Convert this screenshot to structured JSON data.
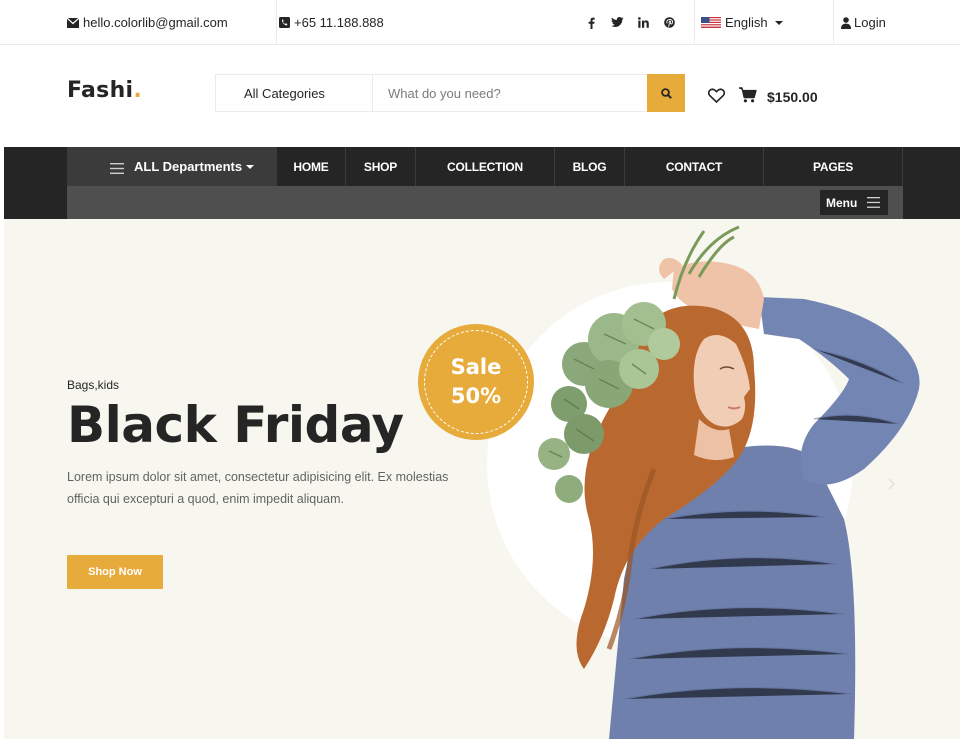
{
  "topbar": {
    "email": "hello.colorlib@gmail.com",
    "phone": "+65 11.188.888",
    "social_icons": [
      "facebook-icon",
      "twitter-icon",
      "linkedin-icon",
      "pinterest-icon"
    ],
    "language": "English",
    "login": "Login"
  },
  "header": {
    "logo_text": "Fashi",
    "logo_dot": ".",
    "category_select": "All Categories",
    "search_placeholder": "What do you need?",
    "cart_total": "$150.00"
  },
  "nav": {
    "departments": "ALL Departments",
    "items": [
      "HOME",
      "SHOP",
      "COLLECTION",
      "BLOG",
      "CONTACT",
      "PAGES"
    ],
    "menu_label": "Menu"
  },
  "hero": {
    "category": "Bags,kids",
    "title": "Black Friday",
    "description": "Lorem ipsum dolor sit amet, consectetur adipisicing elit. Ex molestias officia qui excepturi a quod, enim impedit aliquam.",
    "button": "Shop Now",
    "sale_line1": "Sale",
    "sale_line2": "50%"
  },
  "colors": {
    "accent": "#e7ab3c",
    "dark": "#252525",
    "hero_bg": "#f7f7f0",
    "sweater": "#6f80ad",
    "hair": "#b9692f"
  }
}
